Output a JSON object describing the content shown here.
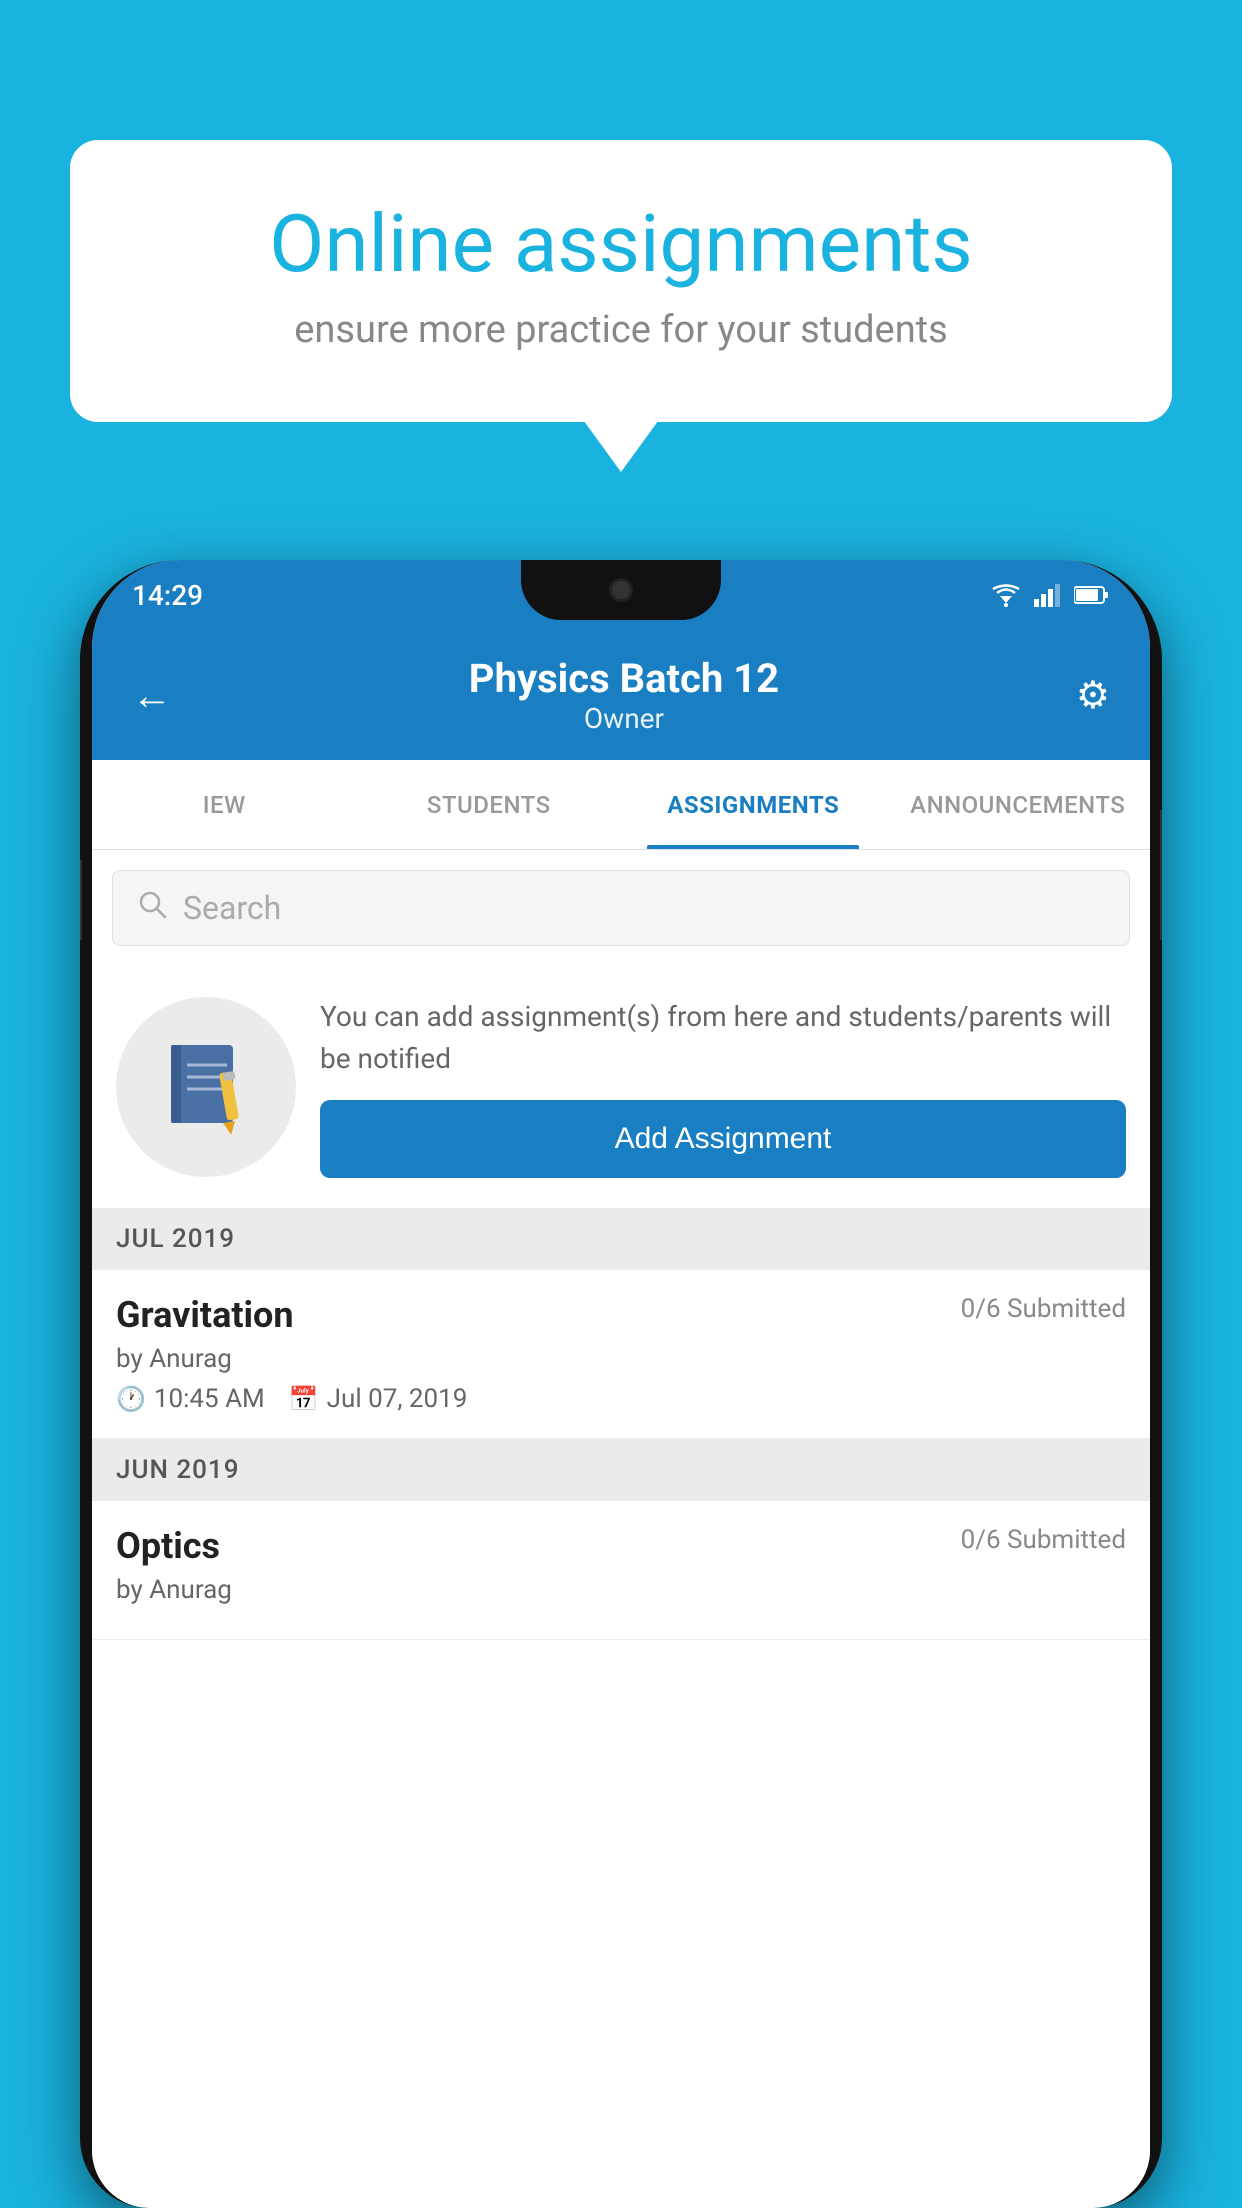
{
  "background": {
    "color": "#1ab3e0"
  },
  "speech_bubble": {
    "title": "Online assignments",
    "subtitle": "ensure more practice for your students"
  },
  "status_bar": {
    "time": "14:29",
    "icons": [
      "wifi",
      "signal",
      "battery"
    ]
  },
  "app_bar": {
    "back_label": "←",
    "title": "Physics Batch 12",
    "subtitle": "Owner",
    "settings_label": "⚙"
  },
  "tabs": [
    {
      "id": "view",
      "label": "IEW"
    },
    {
      "id": "students",
      "label": "STUDENTS"
    },
    {
      "id": "assignments",
      "label": "ASSIGNMENTS",
      "active": true
    },
    {
      "id": "announcements",
      "label": "ANNOUNCEMENTS"
    }
  ],
  "search": {
    "placeholder": "Search"
  },
  "promo": {
    "text": "You can add assignment(s) from here and students/parents will be notified",
    "button_label": "Add Assignment"
  },
  "sections": [
    {
      "label": "JUL 2019",
      "assignments": [
        {
          "name": "Gravitation",
          "status": "0/6 Submitted",
          "author": "by Anurag",
          "time": "10:45 AM",
          "date": "Jul 07, 2019"
        }
      ]
    },
    {
      "label": "JUN 2019",
      "assignments": [
        {
          "name": "Optics",
          "status": "0/6 Submitted",
          "author": "by Anurag",
          "time": "",
          "date": ""
        }
      ]
    }
  ]
}
